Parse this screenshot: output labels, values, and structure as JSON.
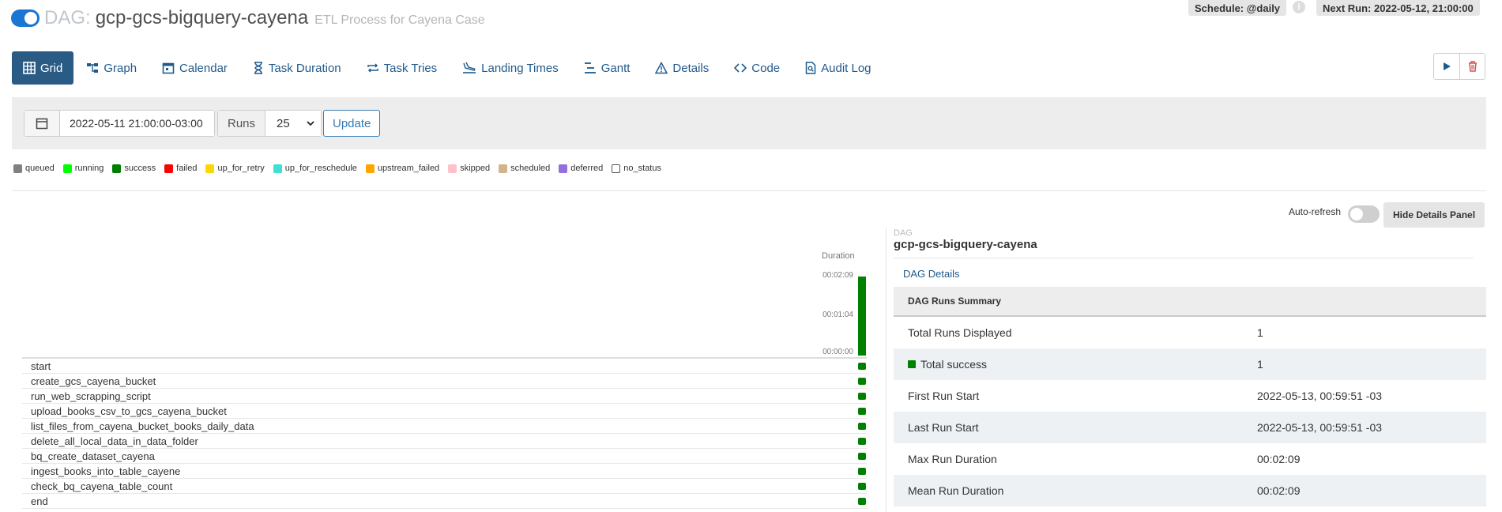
{
  "header": {
    "dag_label": "DAG:",
    "dag_id": "gcp-gcs-bigquery-cayena",
    "description": "ETL Process for Cayena Case",
    "schedule": "Schedule: @daily",
    "next_run": "Next Run: 2022-05-12, 21:00:00",
    "info": "i"
  },
  "nav": {
    "items": [
      {
        "label": "Grid",
        "icon": "grid-icon"
      },
      {
        "label": "Graph",
        "icon": "graph-icon"
      },
      {
        "label": "Calendar",
        "icon": "calendar-icon"
      },
      {
        "label": "Task Duration",
        "icon": "hourglass-icon"
      },
      {
        "label": "Task Tries",
        "icon": "retry-icon"
      },
      {
        "label": "Landing Times",
        "icon": "landing-icon"
      },
      {
        "label": "Gantt",
        "icon": "gantt-icon"
      },
      {
        "label": "Details",
        "icon": "warning-triangle-icon"
      },
      {
        "label": "Code",
        "icon": "code-icon"
      },
      {
        "label": "Audit Log",
        "icon": "search-document-icon"
      }
    ]
  },
  "filters": {
    "date_value": "2022-05-11 21:00:00-03:00",
    "runs_label": "Runs",
    "runs_value": "25",
    "update_label": "Update"
  },
  "legend": [
    {
      "label": "queued",
      "color": "#808080"
    },
    {
      "label": "running",
      "color": "#00ff00"
    },
    {
      "label": "success",
      "color": "#008000"
    },
    {
      "label": "failed",
      "color": "#ff0000"
    },
    {
      "label": "up_for_retry",
      "color": "#ffd700"
    },
    {
      "label": "up_for_reschedule",
      "color": "#40e0d0"
    },
    {
      "label": "upstream_failed",
      "color": "#ffa500"
    },
    {
      "label": "skipped",
      "color": "#ffc0cb"
    },
    {
      "label": "scheduled",
      "color": "#d2b48c"
    },
    {
      "label": "deferred",
      "color": "#9370db"
    },
    {
      "label": "no_status",
      "color": "#ffffff"
    }
  ],
  "controls": {
    "auto_refresh": "Auto-refresh",
    "hide_details": "Hide Details Panel"
  },
  "grid": {
    "duration_title": "Duration",
    "duration_ticks": [
      "00:02:09",
      "00:01:04",
      "00:00:00"
    ],
    "tasks": [
      {
        "name": "start",
        "status": "success"
      },
      {
        "name": "create_gcs_cayena_bucket",
        "status": "success"
      },
      {
        "name": "run_web_scrapping_script",
        "status": "success"
      },
      {
        "name": "upload_books_csv_to_gcs_cayena_bucket",
        "status": "success"
      },
      {
        "name": "list_files_from_cayena_bucket_books_daily_data",
        "status": "success"
      },
      {
        "name": "delete_all_local_data_in_data_folder",
        "status": "success"
      },
      {
        "name": "bq_create_dataset_cayena",
        "status": "success"
      },
      {
        "name": "ingest_books_into_table_cayene",
        "status": "success"
      },
      {
        "name": "check_bq_cayena_table_count",
        "status": "success"
      },
      {
        "name": "end",
        "status": "success"
      }
    ]
  },
  "details": {
    "label": "DAG",
    "dag_id": "gcp-gcs-bigquery-cayena",
    "tab": "DAG Details",
    "summary_title": "DAG Runs Summary",
    "rows": [
      {
        "key": "Total Runs Displayed",
        "value": "1"
      },
      {
        "key": "Total success",
        "value": "1"
      },
      {
        "key": "First Run Start",
        "value": "2022-05-13, 00:59:51 -03"
      },
      {
        "key": "Last Run Start",
        "value": "2022-05-13, 00:59:51 -03"
      },
      {
        "key": "Max Run Duration",
        "value": "00:02:09"
      },
      {
        "key": "Mean Run Duration",
        "value": "00:02:09"
      }
    ]
  }
}
